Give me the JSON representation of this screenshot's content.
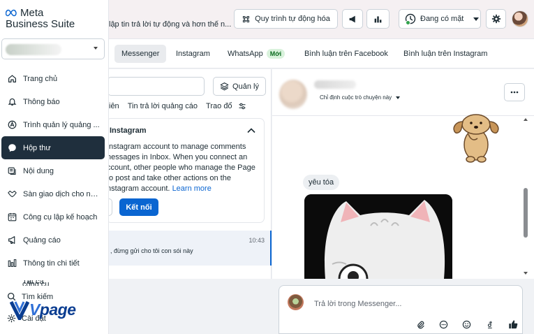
{
  "topbar": {
    "banner_text": "lập tin trả lời tự động và hơn thế n...",
    "automation_label": "Quy trình tự động hóa",
    "presence_label": "Đang có mặt"
  },
  "sidebar": {
    "brand_line1": "Meta",
    "brand_line2": "Business Suite",
    "items": [
      {
        "label": "Trang chủ",
        "icon": "home-icon"
      },
      {
        "label": "Thông báo",
        "icon": "bell-icon"
      },
      {
        "label": "Trình quản lý quảng ...",
        "icon": "ads-manager-icon"
      },
      {
        "label": "Hộp thư",
        "icon": "chat-icon"
      },
      {
        "label": "Nội dung",
        "icon": "content-icon"
      },
      {
        "label": "Sàn giao dịch cho ng...",
        "icon": "handshake-icon"
      },
      {
        "label": "Công cụ lập kế hoạch",
        "icon": "calendar-icon"
      },
      {
        "label": "Quảng cáo",
        "icon": "megaphone-icon"
      },
      {
        "label": "Thông tin chi tiết",
        "icon": "insights-icon"
      }
    ],
    "clipped_item": "Tất cả công cụ",
    "search_label": "Tìm kiếm",
    "settings_label": "Cài đặt"
  },
  "watermark": {
    "text_before": "",
    "text_v": "V",
    "text_after": "page"
  },
  "tabs": [
    {
      "label": "Messenger",
      "active": true
    },
    {
      "label": "Instagram"
    },
    {
      "label": "WhatsApp",
      "badge": "Mới"
    },
    {
      "label": "Bình luận trên Facebook"
    },
    {
      "label": "Bình luận trên Instagram"
    }
  ],
  "inbox": {
    "manage_label": "Quản lý",
    "filters": [
      "iên",
      "Tin trả lời quảng cáo",
      "Trao đổ"
    ],
    "card": {
      "title": "Instagram",
      "lines": [
        "Instagram account to manage comments",
        "nessages in Inbox. When you connect an",
        "ccount, other people who manage the Page",
        "to post and take other actions on the"
      ],
      "last_line": "nstagram account.",
      "learn_more": "Learn more",
      "connect_label": "Kết nối"
    },
    "conversation": {
      "preview": ", đừng gửi cho tôi con sói này",
      "time": "10:43"
    }
  },
  "chat": {
    "assign_label": "Chỉ định cuộc trò chuyện này",
    "message_text": "yêu tóa",
    "composer_placeholder": "Trả lời trong Messenger...",
    "colors": {
      "primary": "#0a65d1",
      "active_nav": "#1f2f3d",
      "status_green": "#31a24c"
    }
  }
}
